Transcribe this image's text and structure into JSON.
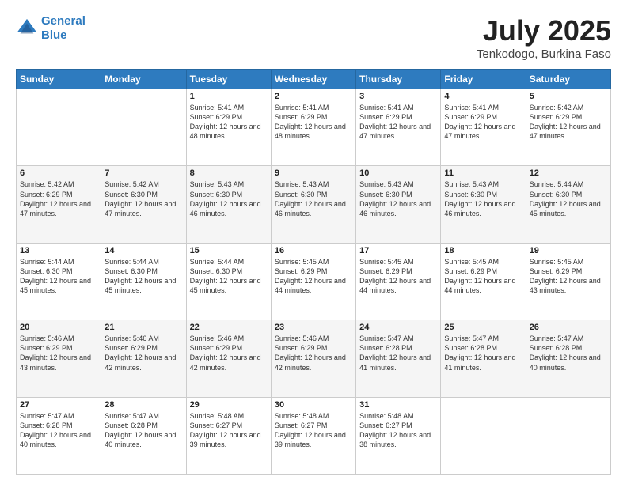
{
  "logo": {
    "line1": "General",
    "line2": "Blue"
  },
  "title": "July 2025",
  "subtitle": "Tenkodogo, Burkina Faso",
  "days_of_week": [
    "Sunday",
    "Monday",
    "Tuesday",
    "Wednesday",
    "Thursday",
    "Friday",
    "Saturday"
  ],
  "weeks": [
    [
      {
        "day": "",
        "info": ""
      },
      {
        "day": "",
        "info": ""
      },
      {
        "day": "1",
        "info": "Sunrise: 5:41 AM\nSunset: 6:29 PM\nDaylight: 12 hours and 48 minutes."
      },
      {
        "day": "2",
        "info": "Sunrise: 5:41 AM\nSunset: 6:29 PM\nDaylight: 12 hours and 48 minutes."
      },
      {
        "day": "3",
        "info": "Sunrise: 5:41 AM\nSunset: 6:29 PM\nDaylight: 12 hours and 47 minutes."
      },
      {
        "day": "4",
        "info": "Sunrise: 5:41 AM\nSunset: 6:29 PM\nDaylight: 12 hours and 47 minutes."
      },
      {
        "day": "5",
        "info": "Sunrise: 5:42 AM\nSunset: 6:29 PM\nDaylight: 12 hours and 47 minutes."
      }
    ],
    [
      {
        "day": "6",
        "info": "Sunrise: 5:42 AM\nSunset: 6:29 PM\nDaylight: 12 hours and 47 minutes."
      },
      {
        "day": "7",
        "info": "Sunrise: 5:42 AM\nSunset: 6:30 PM\nDaylight: 12 hours and 47 minutes."
      },
      {
        "day": "8",
        "info": "Sunrise: 5:43 AM\nSunset: 6:30 PM\nDaylight: 12 hours and 46 minutes."
      },
      {
        "day": "9",
        "info": "Sunrise: 5:43 AM\nSunset: 6:30 PM\nDaylight: 12 hours and 46 minutes."
      },
      {
        "day": "10",
        "info": "Sunrise: 5:43 AM\nSunset: 6:30 PM\nDaylight: 12 hours and 46 minutes."
      },
      {
        "day": "11",
        "info": "Sunrise: 5:43 AM\nSunset: 6:30 PM\nDaylight: 12 hours and 46 minutes."
      },
      {
        "day": "12",
        "info": "Sunrise: 5:44 AM\nSunset: 6:30 PM\nDaylight: 12 hours and 45 minutes."
      }
    ],
    [
      {
        "day": "13",
        "info": "Sunrise: 5:44 AM\nSunset: 6:30 PM\nDaylight: 12 hours and 45 minutes."
      },
      {
        "day": "14",
        "info": "Sunrise: 5:44 AM\nSunset: 6:30 PM\nDaylight: 12 hours and 45 minutes."
      },
      {
        "day": "15",
        "info": "Sunrise: 5:44 AM\nSunset: 6:30 PM\nDaylight: 12 hours and 45 minutes."
      },
      {
        "day": "16",
        "info": "Sunrise: 5:45 AM\nSunset: 6:29 PM\nDaylight: 12 hours and 44 minutes."
      },
      {
        "day": "17",
        "info": "Sunrise: 5:45 AM\nSunset: 6:29 PM\nDaylight: 12 hours and 44 minutes."
      },
      {
        "day": "18",
        "info": "Sunrise: 5:45 AM\nSunset: 6:29 PM\nDaylight: 12 hours and 44 minutes."
      },
      {
        "day": "19",
        "info": "Sunrise: 5:45 AM\nSunset: 6:29 PM\nDaylight: 12 hours and 43 minutes."
      }
    ],
    [
      {
        "day": "20",
        "info": "Sunrise: 5:46 AM\nSunset: 6:29 PM\nDaylight: 12 hours and 43 minutes."
      },
      {
        "day": "21",
        "info": "Sunrise: 5:46 AM\nSunset: 6:29 PM\nDaylight: 12 hours and 42 minutes."
      },
      {
        "day": "22",
        "info": "Sunrise: 5:46 AM\nSunset: 6:29 PM\nDaylight: 12 hours and 42 minutes."
      },
      {
        "day": "23",
        "info": "Sunrise: 5:46 AM\nSunset: 6:29 PM\nDaylight: 12 hours and 42 minutes."
      },
      {
        "day": "24",
        "info": "Sunrise: 5:47 AM\nSunset: 6:28 PM\nDaylight: 12 hours and 41 minutes."
      },
      {
        "day": "25",
        "info": "Sunrise: 5:47 AM\nSunset: 6:28 PM\nDaylight: 12 hours and 41 minutes."
      },
      {
        "day": "26",
        "info": "Sunrise: 5:47 AM\nSunset: 6:28 PM\nDaylight: 12 hours and 40 minutes."
      }
    ],
    [
      {
        "day": "27",
        "info": "Sunrise: 5:47 AM\nSunset: 6:28 PM\nDaylight: 12 hours and 40 minutes."
      },
      {
        "day": "28",
        "info": "Sunrise: 5:47 AM\nSunset: 6:28 PM\nDaylight: 12 hours and 40 minutes."
      },
      {
        "day": "29",
        "info": "Sunrise: 5:48 AM\nSunset: 6:27 PM\nDaylight: 12 hours and 39 minutes."
      },
      {
        "day": "30",
        "info": "Sunrise: 5:48 AM\nSunset: 6:27 PM\nDaylight: 12 hours and 39 minutes."
      },
      {
        "day": "31",
        "info": "Sunrise: 5:48 AM\nSunset: 6:27 PM\nDaylight: 12 hours and 38 minutes."
      },
      {
        "day": "",
        "info": ""
      },
      {
        "day": "",
        "info": ""
      }
    ]
  ]
}
